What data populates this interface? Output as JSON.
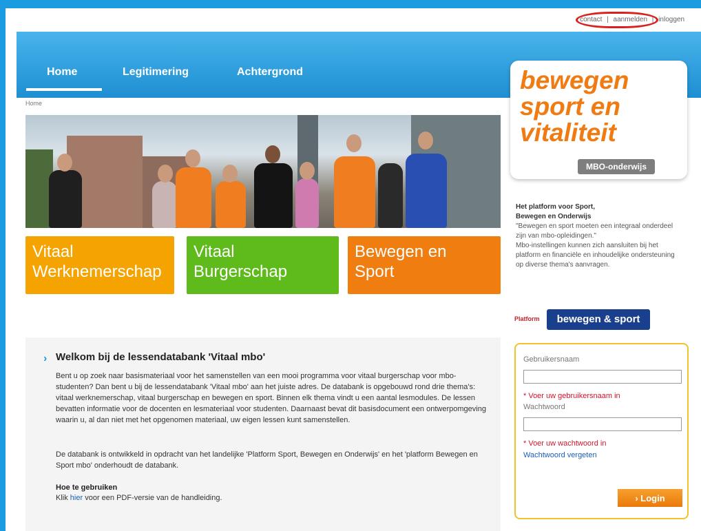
{
  "header": {
    "links": [
      "contact",
      "aanmelden",
      "inloggen"
    ],
    "separator": "|",
    "highlighted": "aanmelden"
  },
  "nav": {
    "tabs": [
      {
        "label": "Home",
        "active": true
      },
      {
        "label": "Legitimering",
        "active": false
      },
      {
        "label": "Achtergrond",
        "active": false
      }
    ]
  },
  "breadcrumb": "Home",
  "tiles": [
    {
      "line1": "Vitaal",
      "line2": "Werknemerschap",
      "color": "#f5a300"
    },
    {
      "line1": "Vitaal",
      "line2": "Burgerschap",
      "color": "#5fba1c"
    },
    {
      "line1": "Bewegen en",
      "line2": "Sport",
      "color": "#f07d0f"
    }
  ],
  "welcome": {
    "title": "Welkom bij de lessendatabank 'Vitaal mbo'",
    "paragraph1": "Bent u op zoek naar basismateriaal voor het samenstellen van een mooi programma voor vitaal burgerschap voor mbo-studenten? Dan bent u bij de lessendatabank 'Vitaal mbo' aan het juiste adres. De databank is opgebouwd rond drie thema's: vitaal werknemerschap, vitaal burgerschap en bewegen en sport. Binnen elk thema vindt u een aantal lesmodules. De lessen bevatten informatie voor de docenten en lesmateriaal voor studenten. Daarnaast bevat dit basisdocument een ontwerpomgeving waarin u, al dan niet met het opgenomen materiaal, uw eigen lessen kunt samenstellen.",
    "paragraph2": "De databank is ontwikkeld in opdracht van het landelijke 'Platform Sport, Bewegen en Onderwijs' en het 'platform Bewegen en Sport mbo' onderhoudt de databank.",
    "how_title": "Hoe te gebruiken",
    "how_prefix": "Klik",
    "how_link": "hier",
    "how_suffix": "voor een PDF-versie van de handleiding."
  },
  "brand": {
    "line1": "bewegen",
    "line2": "sport en",
    "line3": "vitaliteit",
    "badge": "MBO-onderwijs"
  },
  "sidebar": {
    "heading_line1": "Het platform voor Sport,",
    "heading_line2": "Bewegen en Onderwijs",
    "quote": "\"Bewegen en sport moeten een integraal onderdeel zijn van mbo-opleidingen.\"",
    "body": "Mbo-instellingen kunnen zich aansluiten bij het platform en financiële en inhoudelijke ondersteuning op diverse thema's aanvragen.",
    "platform_label": "Platform",
    "platform_badge": "bewegen & sport"
  },
  "login": {
    "username_label": "Gebruikersnaam",
    "username_value": "",
    "username_error": "* Voer uw gebruikersnaam in",
    "password_label": "Wachtwoord",
    "password_value": "",
    "password_error": "* Voer uw wachtwoord in",
    "forgot": "Wachtwoord vergeten",
    "button": "› Login"
  },
  "colors": {
    "header_blue": "#1b9be0",
    "brand_orange": "#f07b12",
    "login_border": "#f2c22b",
    "error_red": "#d0142a"
  }
}
